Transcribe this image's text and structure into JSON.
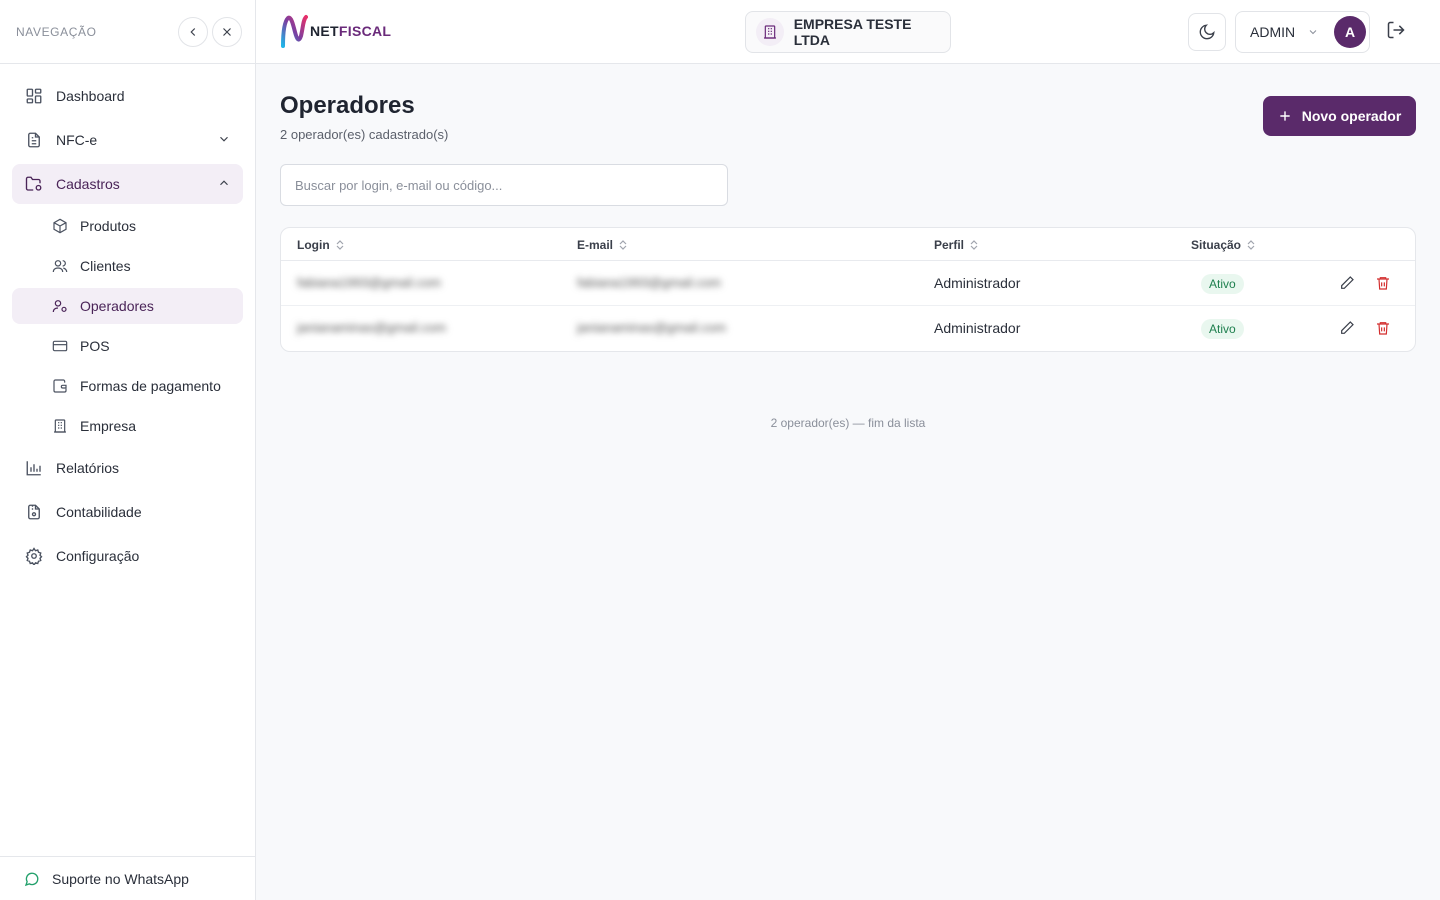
{
  "sidebar": {
    "title": "NAVEGAÇÃO",
    "items": [
      {
        "label": "Dashboard",
        "icon": "dashboard-icon"
      },
      {
        "label": "NFC-e",
        "icon": "document-icon"
      },
      {
        "label": "Cadastros",
        "icon": "folder-settings-icon"
      },
      {
        "label": "Relatórios",
        "icon": "bar-chart-icon"
      },
      {
        "label": "Contabilidade",
        "icon": "file-lock-icon"
      },
      {
        "label": "Configuração",
        "icon": "gear-icon"
      }
    ],
    "sub_items": [
      {
        "label": "Produtos",
        "icon": "box-icon"
      },
      {
        "label": "Clientes",
        "icon": "users-icon"
      },
      {
        "label": "Operadores",
        "icon": "user-key-icon"
      },
      {
        "label": "POS",
        "icon": "card-icon"
      },
      {
        "label": "Formas de pagamento",
        "icon": "wallet-icon"
      },
      {
        "label": "Empresa",
        "icon": "building-icon"
      }
    ],
    "footer": "Suporte no WhatsApp"
  },
  "topbar": {
    "logo_net": "NET",
    "logo_fiscal": "FISCAL",
    "company": "EMPRESA TESTE LTDA",
    "user": "ADMIN",
    "avatar_letter": "A"
  },
  "page": {
    "title": "Operadores",
    "subtitle": "2 operador(es) cadastrado(s)",
    "new_button": "Novo operador",
    "search_placeholder": "Buscar por login, e-mail ou código...",
    "footnote": "2 operador(es) — fim da lista"
  },
  "table": {
    "columns": [
      "Login",
      "E-mail",
      "Perfil",
      "Situação"
    ],
    "rows": [
      {
        "login": "fabiana1993@gmail.com",
        "email": "fabiana1993@gmail.com",
        "perfil": "Administrador",
        "situacao": "Ativo"
      },
      {
        "login": "janianaminas@gmail.com",
        "email": "janianaminas@gmail.com",
        "perfil": "Administrador",
        "situacao": "Ativo"
      }
    ]
  },
  "colors": {
    "brand": "#5a2a6a",
    "active_bg": "#f3eef6",
    "status_green": "#1e7f4e",
    "danger": "#d32f2f"
  }
}
